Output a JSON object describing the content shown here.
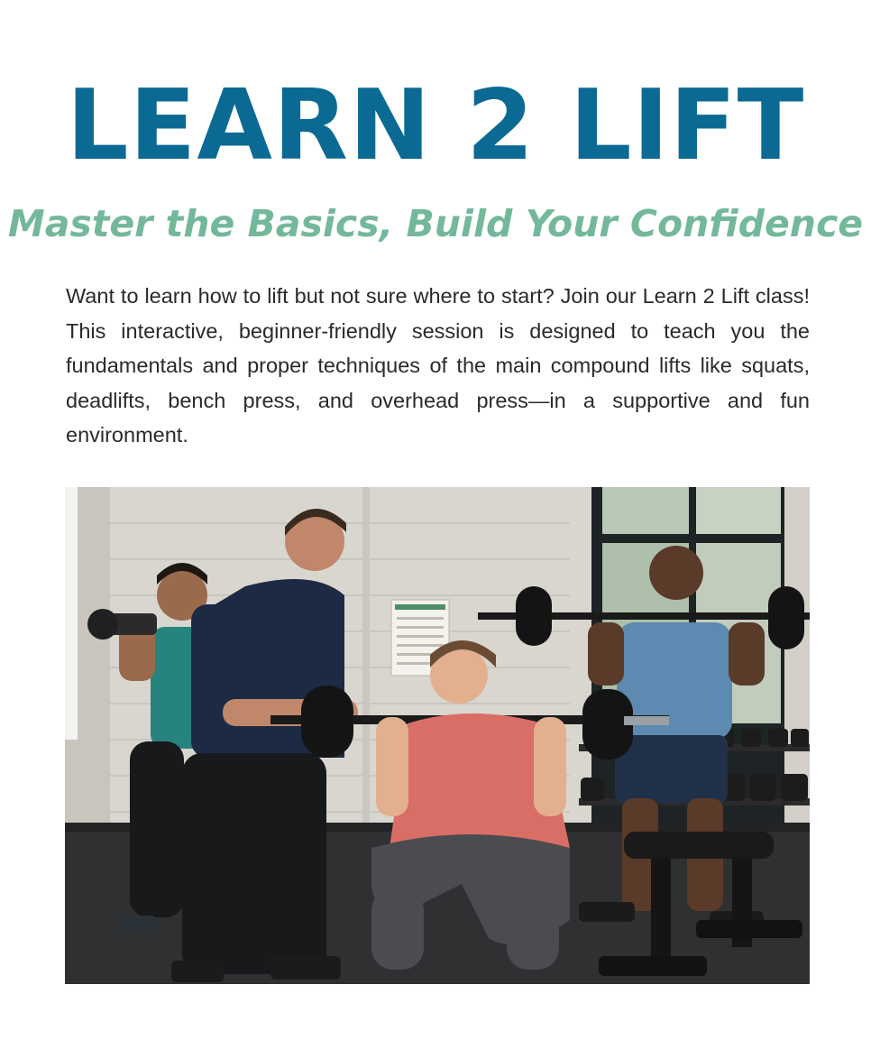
{
  "header": {
    "title": "LEARN 2 LIFT",
    "subtitle": "Master the Basics, Build Your Confidence"
  },
  "intro": {
    "text": "Want to learn how to lift but not sure where to start? Join our Learn 2 Lift class! This interactive, beginner-friendly session is designed to teach you the fundamentals and proper techniques of the main compound lifts like squats, deadlifts, bench press, and overhead press—in a supportive and fun environment."
  },
  "photo": {
    "icon": "gym-class-photo"
  },
  "colors": {
    "title": "#0b6a93",
    "subtitle": "#73b89a",
    "body_text": "#2a2a2a"
  }
}
